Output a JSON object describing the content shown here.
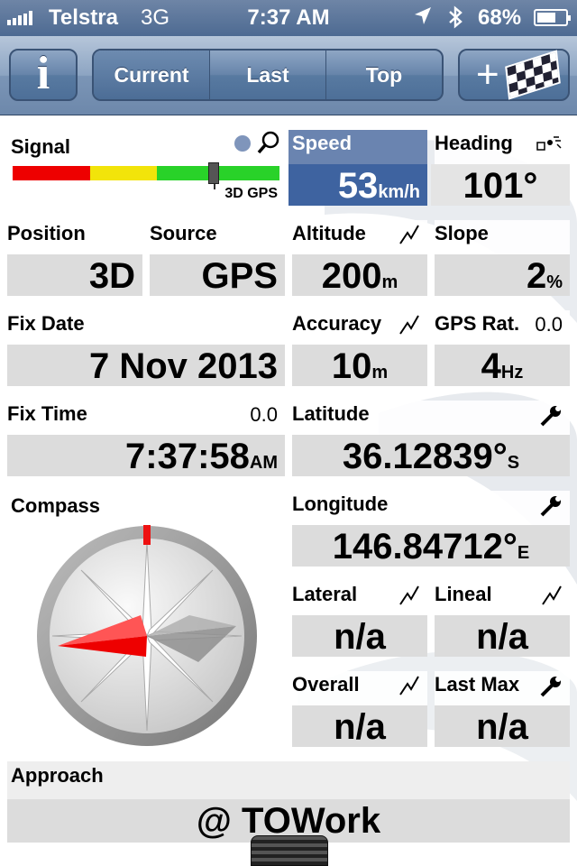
{
  "status_bar": {
    "carrier": "Telstra",
    "network": "3G",
    "time": "7:37 AM",
    "battery": "68%",
    "battery_level": 0.68,
    "location_icon": "location-arrow-icon",
    "bluetooth_icon": "bluetooth-icon"
  },
  "nav": {
    "info_label": "i",
    "segments": [
      "Current",
      "Last",
      "Top"
    ],
    "active_segment": "Current",
    "add_label": "+"
  },
  "signal": {
    "label": "Signal",
    "status": "3D GPS",
    "colors": [
      "#ee0000",
      "#f2e40a",
      "#29d229"
    ]
  },
  "speed": {
    "label": "Speed",
    "value": "53",
    "unit": "km/h"
  },
  "heading": {
    "label": "Heading",
    "value": "101°",
    "icon": "gps-satellite-icon"
  },
  "position": {
    "label": "Position",
    "value": "3D"
  },
  "source": {
    "label": "Source",
    "value": "GPS"
  },
  "altitude": {
    "label": "Altitude",
    "value": "200",
    "unit": "m",
    "icon": "graph-icon"
  },
  "slope": {
    "label": "Slope",
    "value": "2",
    "unit": "%"
  },
  "fix_date": {
    "label": "Fix Date",
    "value": "7 Nov 2013"
  },
  "accuracy": {
    "label": "Accuracy",
    "value": "10",
    "unit": "m",
    "icon": "graph-icon"
  },
  "gps_rate": {
    "label": "GPS Rat.",
    "extra": "0.0",
    "value": "4",
    "unit": "Hz"
  },
  "fix_time": {
    "label": "Fix Time",
    "extra": "0.0",
    "value": "7:37:58",
    "unit": "AM"
  },
  "latitude": {
    "label": "Latitude",
    "value": "36.12839°",
    "unit": "S",
    "icon": "wrench-icon"
  },
  "compass": {
    "label": "Compass",
    "icon": "gps-satellite-icon",
    "heading_deg": 101
  },
  "longitude": {
    "label": "Longitude",
    "value": "146.84712°",
    "unit": "E",
    "icon": "wrench-icon"
  },
  "lateral": {
    "label": "Lateral",
    "value": "n/a",
    "icon": "graph-icon"
  },
  "lineal": {
    "label": "Lineal",
    "value": "n/a",
    "icon": "graph-icon"
  },
  "overall": {
    "label": "Overall",
    "value": "n/a",
    "icon": "graph-icon"
  },
  "last_max": {
    "label": "Last Max",
    "value": "n/a",
    "icon": "wrench-icon"
  },
  "approach": {
    "label": "Approach",
    "value": "@ TOWork"
  }
}
